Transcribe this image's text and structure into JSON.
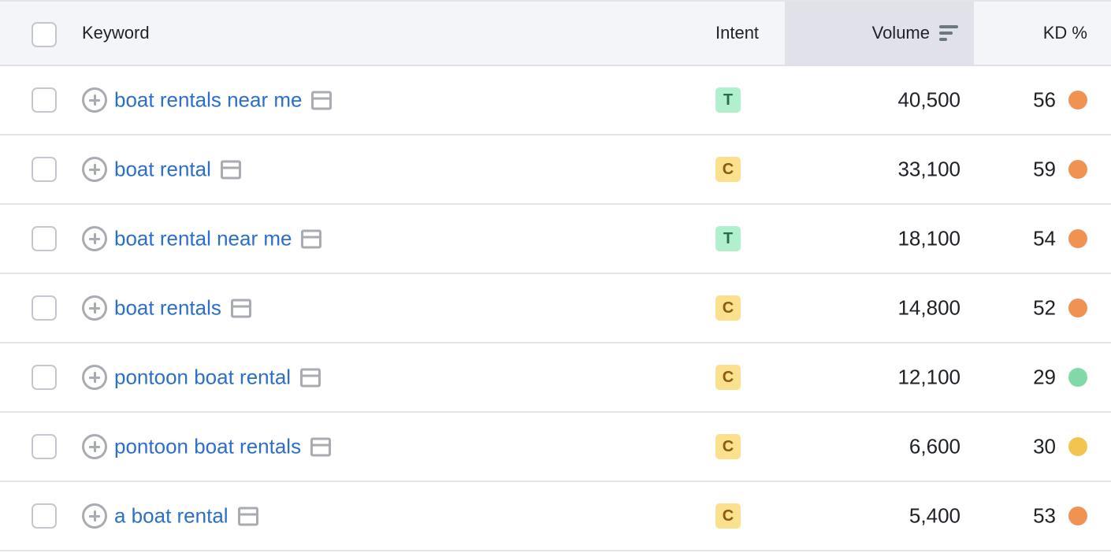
{
  "header": {
    "keyword": "Keyword",
    "intent": "Intent",
    "volume": "Volume",
    "kd": "KD %",
    "sort_icon": "sort-descending-icon"
  },
  "colors": {
    "link": "#2b6fcb",
    "kd_hard": "#f09352",
    "kd_easy": "#7fd9a8",
    "kd_medium": "#f3c550",
    "intent_T": "#b1f0cf",
    "intent_C": "#fbe08e"
  },
  "rows": [
    {
      "keyword": "boat rentals near me",
      "intent": "T",
      "volume": "40,500",
      "kd": "56",
      "kd_color": "#f09352"
    },
    {
      "keyword": "boat rental",
      "intent": "C",
      "volume": "33,100",
      "kd": "59",
      "kd_color": "#f09352"
    },
    {
      "keyword": "boat rental near me",
      "intent": "T",
      "volume": "18,100",
      "kd": "54",
      "kd_color": "#f09352"
    },
    {
      "keyword": "boat rentals",
      "intent": "C",
      "volume": "14,800",
      "kd": "52",
      "kd_color": "#f09352"
    },
    {
      "keyword": "pontoon boat rental",
      "intent": "C",
      "volume": "12,100",
      "kd": "29",
      "kd_color": "#7fd9a8"
    },
    {
      "keyword": "pontoon boat rentals",
      "intent": "C",
      "volume": "6,600",
      "kd": "30",
      "kd_color": "#f3c550"
    },
    {
      "keyword": "a boat rental",
      "intent": "C",
      "volume": "5,400",
      "kd": "53",
      "kd_color": "#f09352"
    }
  ]
}
